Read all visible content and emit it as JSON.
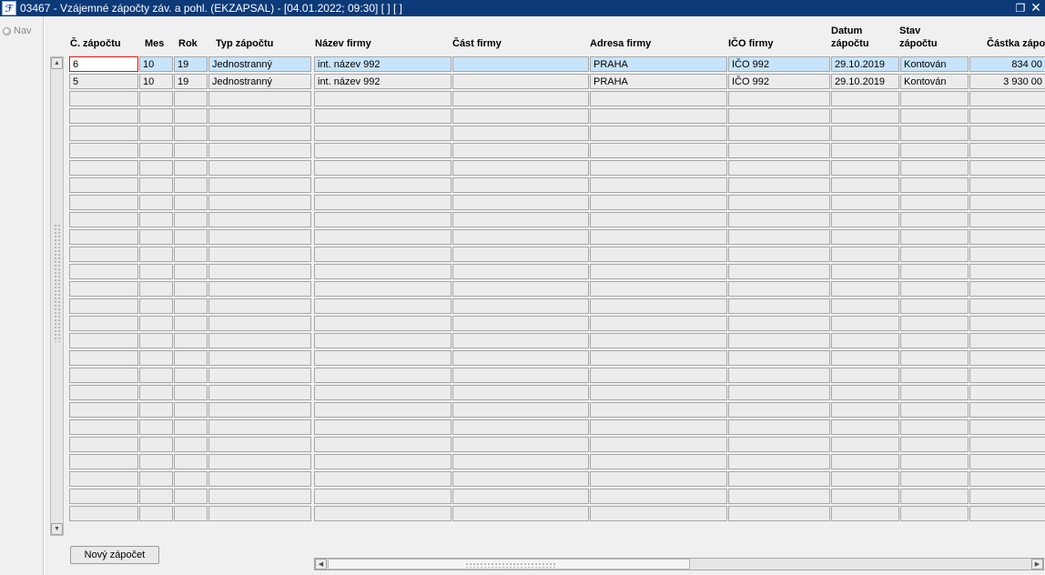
{
  "window": {
    "logo_text": "ℱ",
    "title": "03467 - Vzájemné zápočty záv. a pohl. (EKZAPSAL) - [04.01.2022; 09:30]  [ ]  [ ]",
    "restore_icon": "restore-icon",
    "close_icon": "close-icon"
  },
  "nav": {
    "label": "Nav"
  },
  "columns": [
    {
      "key": "cislo",
      "label": "Č. zápočtu"
    },
    {
      "key": "mes",
      "label": "Mes"
    },
    {
      "key": "rok",
      "label": "Rok"
    },
    {
      "key": "typ",
      "label": "Typ zápočtu"
    },
    {
      "key": "nazev",
      "label": "Název firmy"
    },
    {
      "key": "cast",
      "label": "Část firmy"
    },
    {
      "key": "adresa",
      "label": "Adresa firmy"
    },
    {
      "key": "ico",
      "label": "IČO firmy"
    },
    {
      "key": "datum",
      "label": "Datum\nzápočtu"
    },
    {
      "key": "stav",
      "label": "Stav\nzápočtu"
    },
    {
      "key": "castka",
      "label": "Částka zápo"
    }
  ],
  "rows": [
    {
      "cislo": "6",
      "mes": "10",
      "rok": "19",
      "typ": "Jednostranný",
      "nazev": "int. název 992",
      "cast": "",
      "adresa": "PRAHA",
      "ico": "IČO 992",
      "datum": "29.10.2019",
      "stav": "Kontován",
      "castka": "834 00"
    },
    {
      "cislo": "5",
      "mes": "10",
      "rok": "19",
      "typ": "Jednostranný",
      "nazev": "int. název 992",
      "cast": "",
      "adresa": "PRAHA",
      "ico": "IČO 992",
      "datum": "29.10.2019",
      "stav": "Kontován",
      "castka": "3 930 00"
    }
  ],
  "empty_row_count": 25,
  "buttons": {
    "new": "Nový zápočet"
  },
  "colors": {
    "titlebar": "#0c3a78",
    "selected_row": "#c7e4fb",
    "focus_border": "#e0181a"
  }
}
